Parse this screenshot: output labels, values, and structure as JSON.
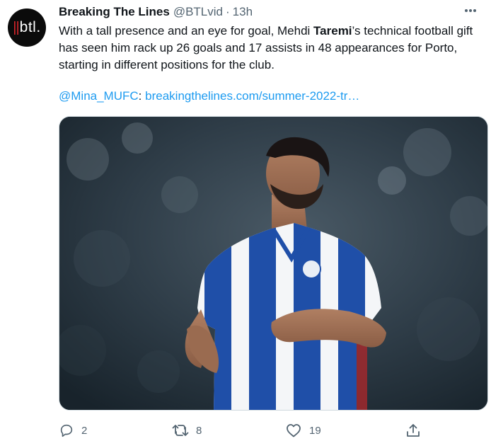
{
  "tweet": {
    "author_name": "Breaking The Lines",
    "handle": "@BTLvid",
    "separator": "·",
    "time": "13h",
    "avatar_text": "btl",
    "text_part1": "With a tall presence and an eye for goal, Mehdi ",
    "text_bold": "Taremi",
    "text_part2": "’s technical football gift has seen him rack up 26 goals and 17 assists in 48 appearances for Porto, starting in different positions for the club.",
    "mention": "@Mina_MUFC",
    "colon": ":",
    "link": "breakingthelines.com/summer-2022-tr…",
    "media_icon_name": "tweet-photo-footballer",
    "actions": {
      "reply_count": "2",
      "retweet_count": "8",
      "like_count": "19"
    }
  },
  "colors": {
    "link": "#1d9bf0",
    "secondary_text": "#536471",
    "avatar_bg": "#0b0b0b",
    "avatar_accent": "#d9252b"
  }
}
